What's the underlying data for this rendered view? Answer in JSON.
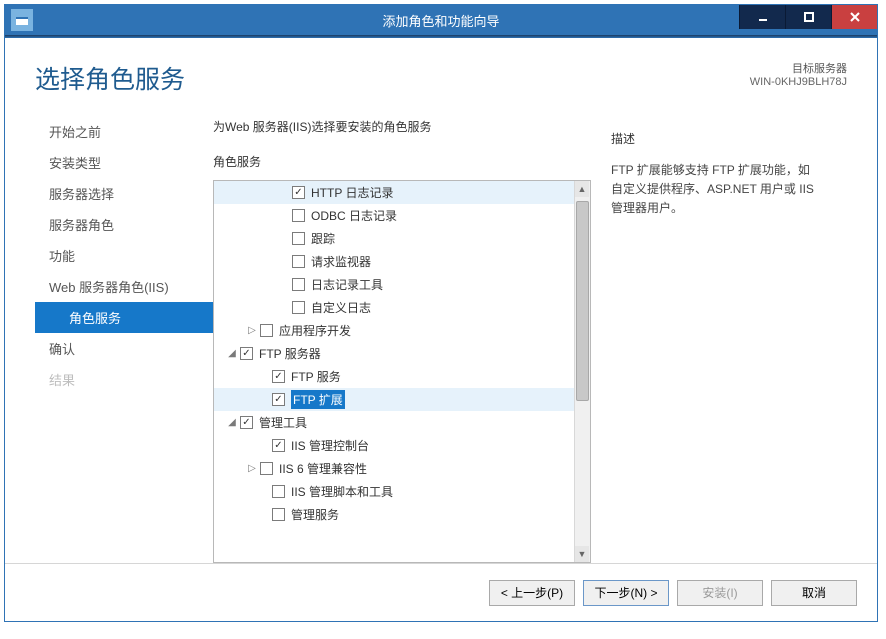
{
  "window": {
    "title": "添加角色和功能向导"
  },
  "page": {
    "title": "选择角色服务"
  },
  "target": {
    "label": "目标服务器",
    "server": "WIN-0KHJ9BLH78J"
  },
  "nav": [
    {
      "label": "开始之前",
      "active": false,
      "disabled": false,
      "indent": false
    },
    {
      "label": "安装类型",
      "active": false,
      "disabled": false,
      "indent": false
    },
    {
      "label": "服务器选择",
      "active": false,
      "disabled": false,
      "indent": false
    },
    {
      "label": "服务器角色",
      "active": false,
      "disabled": false,
      "indent": false
    },
    {
      "label": "功能",
      "active": false,
      "disabled": false,
      "indent": false
    },
    {
      "label": "Web 服务器角色(IIS)",
      "active": false,
      "disabled": false,
      "indent": false
    },
    {
      "label": "角色服务",
      "active": true,
      "disabled": false,
      "indent": true
    },
    {
      "label": "确认",
      "active": false,
      "disabled": false,
      "indent": false
    },
    {
      "label": "结果",
      "active": false,
      "disabled": true,
      "indent": false
    }
  ],
  "instruction": "为Web 服务器(IIS)选择要安装的角色服务",
  "section_heading": "角色服务",
  "tree": [
    {
      "indent": 60,
      "exp": "",
      "checked": true,
      "label": "HTTP 日志记录",
      "state": "line"
    },
    {
      "indent": 60,
      "exp": "",
      "checked": false,
      "label": "ODBC 日志记录",
      "state": ""
    },
    {
      "indent": 60,
      "exp": "",
      "checked": false,
      "label": "跟踪",
      "state": ""
    },
    {
      "indent": 60,
      "exp": "",
      "checked": false,
      "label": "请求监视器",
      "state": ""
    },
    {
      "indent": 60,
      "exp": "",
      "checked": false,
      "label": "日志记录工具",
      "state": ""
    },
    {
      "indent": 60,
      "exp": "",
      "checked": false,
      "label": "自定义日志",
      "state": ""
    },
    {
      "indent": 28,
      "exp": "▷",
      "checked": false,
      "label": "应用程序开发",
      "state": ""
    },
    {
      "indent": 8,
      "exp": "◢",
      "checked": true,
      "label": "FTP 服务器",
      "state": ""
    },
    {
      "indent": 40,
      "exp": "",
      "checked": true,
      "label": "FTP 服务",
      "state": ""
    },
    {
      "indent": 40,
      "exp": "",
      "checked": true,
      "label": "FTP 扩展",
      "state": "selected"
    },
    {
      "indent": 8,
      "exp": "◢",
      "checked": true,
      "label": "管理工具",
      "state": ""
    },
    {
      "indent": 40,
      "exp": "",
      "checked": true,
      "label": "IIS 管理控制台",
      "state": ""
    },
    {
      "indent": 28,
      "exp": "▷",
      "checked": false,
      "label": "IIS 6 管理兼容性",
      "state": ""
    },
    {
      "indent": 40,
      "exp": "",
      "checked": false,
      "label": "IIS 管理脚本和工具",
      "state": ""
    },
    {
      "indent": 40,
      "exp": "",
      "checked": false,
      "label": "管理服务",
      "state": ""
    }
  ],
  "description": {
    "head": "描述",
    "text": "FTP 扩展能够支持 FTP 扩展功能，如自定义提供程序、ASP.NET 用户或 IIS 管理器用户。"
  },
  "buttons": {
    "prev": "< 上一步(P)",
    "next": "下一步(N) >",
    "install": "安装(I)",
    "cancel": "取消"
  }
}
